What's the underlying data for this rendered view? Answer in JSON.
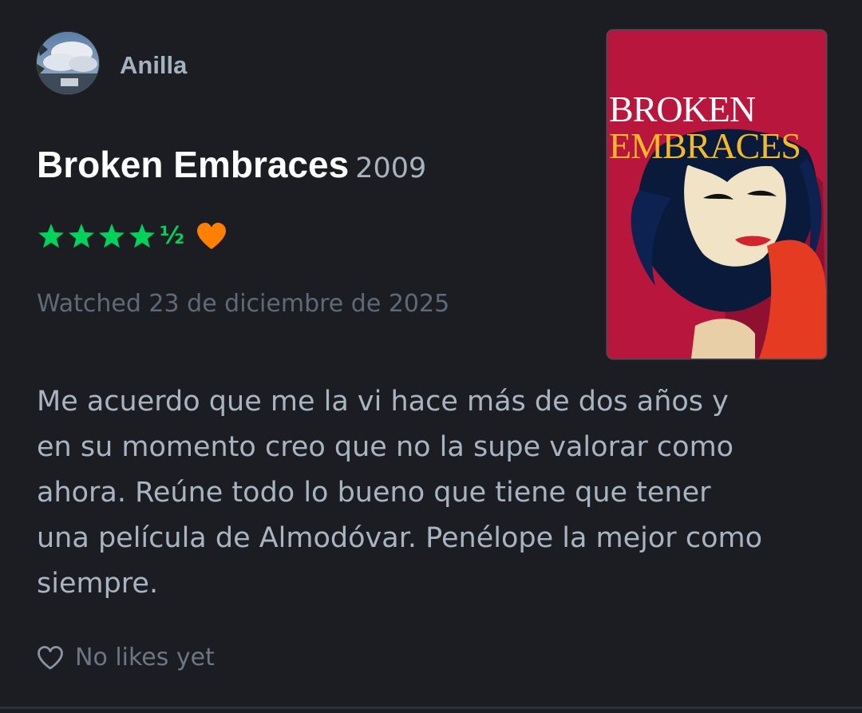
{
  "user": {
    "name": "Anilla"
  },
  "film": {
    "title": "Broken Embraces",
    "year": "2009"
  },
  "rating": {
    "stars": 4.5,
    "half_glyph": "½",
    "liked": true,
    "star_color": "#00d35b",
    "heart_color": "#ff8000"
  },
  "watched": "Watched 23 de diciembre de 2025",
  "poster": {
    "title_line1": "BROKEN",
    "title_line2": "EMBRACES"
  },
  "review": {
    "lines": [
      "Me acuerdo que me la vi hace más de dos años y",
      "en su momento creo que no la supe valorar como",
      "ahora. Reúne todo lo bueno que tiene que tener",
      "una película de Almodóvar. Penélope la mejor como",
      "siempre."
    ]
  },
  "likes": {
    "text": "No likes yet",
    "icon": "heart-outline-icon"
  }
}
